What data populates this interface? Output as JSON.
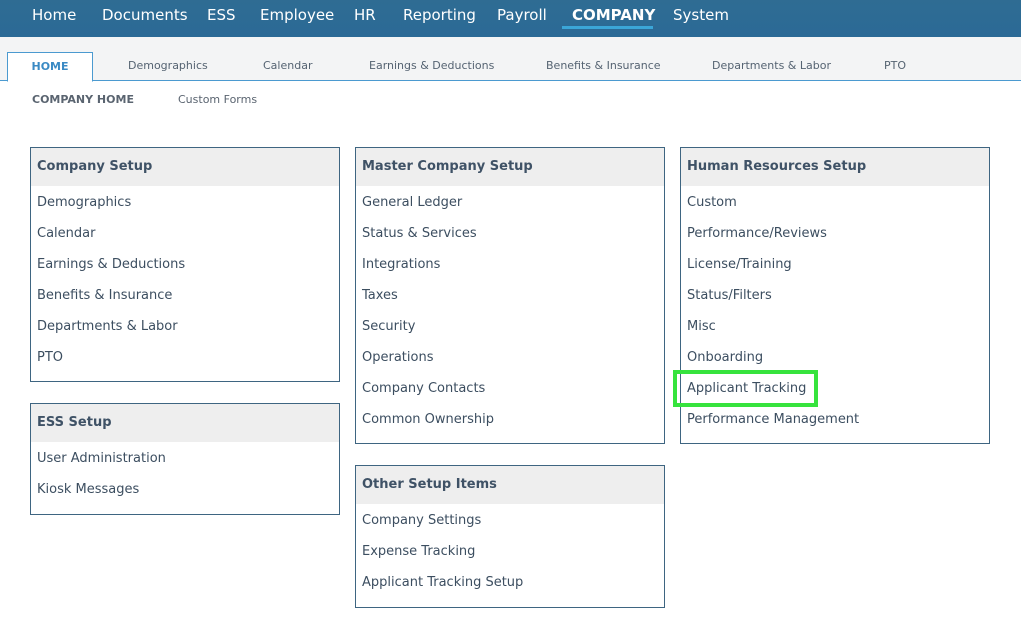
{
  "topnav": {
    "items": [
      "Home",
      "Documents",
      "ESS",
      "Employee",
      "HR",
      "Reporting",
      "Payroll",
      "COMPANY",
      "System"
    ]
  },
  "tabs": [
    "HOME",
    "Demographics",
    "Calendar",
    "Earnings & Deductions",
    "Benefits & Insurance",
    "Departments & Labor",
    "PTO"
  ],
  "subnav": [
    "COMPANY HOME",
    "Custom Forms"
  ],
  "panels": {
    "company_setup": {
      "title": "Company Setup",
      "items": [
        "Demographics",
        "Calendar",
        "Earnings & Deductions",
        "Benefits & Insurance",
        "Departments & Labor",
        "PTO"
      ]
    },
    "ess_setup": {
      "title": "ESS Setup",
      "items": [
        "User Administration",
        "Kiosk Messages"
      ]
    },
    "master_company_setup": {
      "title": "Master Company Setup",
      "items": [
        "General Ledger",
        "Status & Services",
        "Integrations",
        "Taxes",
        "Security",
        "Operations",
        "Company Contacts",
        "Common Ownership"
      ]
    },
    "other_setup_items": {
      "title": "Other Setup Items",
      "items": [
        "Company Settings",
        "Expense Tracking",
        "Applicant Tracking Setup"
      ]
    },
    "hr_setup": {
      "title": "Human Resources Setup",
      "items": [
        "Custom",
        "Performance/Reviews",
        "License/Training",
        "Status/Filters",
        "Misc",
        "Onboarding",
        "Applicant Tracking",
        "Performance Management"
      ]
    }
  },
  "colors": {
    "nav_bg": "#2f6c93",
    "accent": "#3ba6d8",
    "highlight": "#36e33d"
  }
}
